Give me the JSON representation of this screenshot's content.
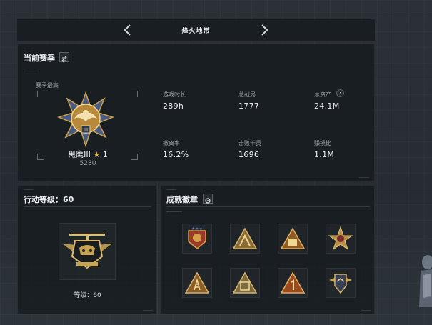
{
  "header": {
    "title": "烽火地带",
    "prev_icon": "chevron-left-icon",
    "next_icon": "chevron-right-icon"
  },
  "season": {
    "title": "当前赛季",
    "toggle_icon": "swap-icon",
    "best_label": "赛季最高",
    "rank_name": "黑鹰III",
    "rank_stars": "1",
    "star_icon": "star-icon",
    "rank_points": "5280",
    "stats": [
      {
        "label": "游戏时长",
        "value": "289h"
      },
      {
        "label": "总战局",
        "value": "1777"
      },
      {
        "label": "总资产",
        "value": "24.1M",
        "help_icon": "?"
      },
      {
        "label": "撤离率",
        "value": "16.2%"
      },
      {
        "label": "击败干员",
        "value": "1696"
      },
      {
        "label": "赚损比",
        "value": "1.1M"
      }
    ]
  },
  "level": {
    "title": "行动等级：60",
    "caption": "等级：60"
  },
  "achievements": {
    "title": "成就徽章",
    "settings_icon": "gear-icon",
    "badges": [
      {
        "name": "badge-star-shield-icon"
      },
      {
        "name": "badge-arch-triangle-icon"
      },
      {
        "name": "badge-bag-triangle-icon"
      },
      {
        "name": "badge-cross-medal-icon"
      },
      {
        "name": "badge-ladder-triangle-icon"
      },
      {
        "name": "badge-crate-triangle-icon"
      },
      {
        "name": "badge-number-one-icon"
      },
      {
        "name": "badge-wing-shield-icon"
      }
    ]
  },
  "colors": {
    "accent_gold": "#c9a24a",
    "panel": "#161b20",
    "text": "#eef1f4"
  }
}
